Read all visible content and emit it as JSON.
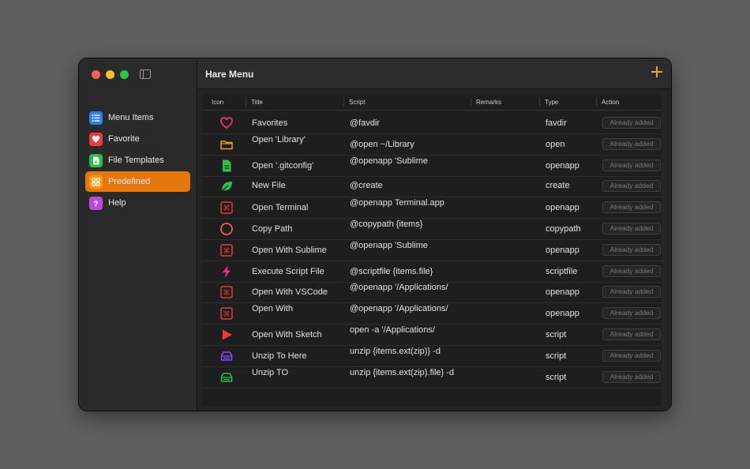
{
  "app": {
    "title": "Hare Menu"
  },
  "sidebar": {
    "items": [
      {
        "label": "Menu Items",
        "icon": "list-icon",
        "color": "#2d7ff0",
        "active": false
      },
      {
        "label": "Favorite",
        "icon": "heart-icon",
        "color": "#ee3b3b",
        "active": false
      },
      {
        "label": "File Templates",
        "icon": "file-template-icon",
        "color": "#2fb94a",
        "active": false
      },
      {
        "label": "Predefined",
        "icon": "grid-icon",
        "color": "#f39a1c",
        "active": true
      },
      {
        "label": "Help",
        "icon": "question-icon",
        "color": "#b84ad8",
        "active": false
      }
    ]
  },
  "table": {
    "columns": [
      "Icon",
      "Title",
      "Script",
      "Remarks",
      "Type",
      "Action"
    ],
    "action_label": "Already added",
    "rows": [
      {
        "icon": "heart-outline-icon",
        "color": "#ff3b7a",
        "title": "Favorites",
        "script": "@favdir",
        "type": "favdir"
      },
      {
        "icon": "folder-icon",
        "color": "#e8a532",
        "title": "Open 'Library'",
        "script": "@open  ~/Library",
        "type": "open"
      },
      {
        "icon": "file-icon",
        "color": "#2fbf4a",
        "title": "Open '.gitconfig'",
        "script": "@openapp  'Sublime",
        "type": "openapp"
      },
      {
        "icon": "leaf-icon",
        "color": "#2fbf4a",
        "title": "New File",
        "script": "@create",
        "type": "create"
      },
      {
        "icon": "command-icon",
        "color": "#e03b3b",
        "title": "Open Terminal",
        "script": "@openapp Terminal.app",
        "type": "openapp"
      },
      {
        "icon": "circle-icon",
        "color": "#ff6a4a",
        "title": "Copy Path",
        "script": "@copypath {items}",
        "type": "copypath"
      },
      {
        "icon": "command-icon",
        "color": "#e03b3b",
        "title": "Open With Sublime",
        "script": "@openapp  'Sublime",
        "type": "openapp"
      },
      {
        "icon": "lightning-icon",
        "color": "#ff2d8a",
        "title": "Execute Script File",
        "script": "@scriptfile {items.file}",
        "type": "scriptfile"
      },
      {
        "icon": "command-icon",
        "color": "#e03b3b",
        "title": "Open With VSCode",
        "script": "@openapp  '/Applications/",
        "type": "openapp"
      },
      {
        "icon": "command-icon",
        "color": "#e03b3b",
        "title": "Open With",
        "script": "@openapp  '/Applications/",
        "type": "openapp"
      },
      {
        "icon": "play-icon",
        "color": "#f03b3b",
        "title": "Open With Sketch",
        "script": "open -a '/Applications/",
        "type": "script"
      },
      {
        "icon": "tray-icon",
        "color": "#8a4bff",
        "title": "Unzip To Here",
        "script": "unzip {items.ext(zip)} -d",
        "type": "script"
      },
      {
        "icon": "tray-icon",
        "color": "#2fbf4a",
        "title": "Unzip TO",
        "script": "unzip {items.ext(zip).file} -d",
        "type": "script"
      }
    ]
  }
}
